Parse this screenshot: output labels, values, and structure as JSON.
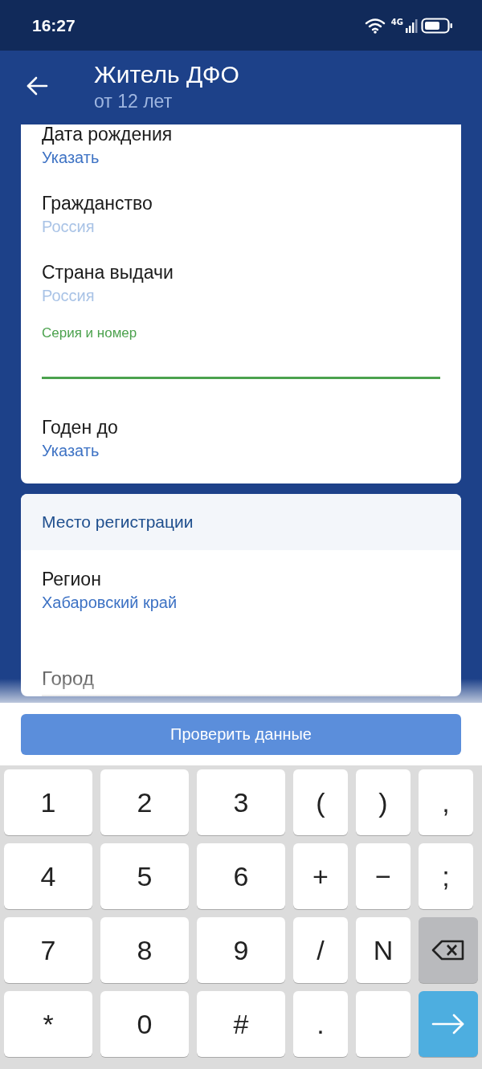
{
  "status_bar": {
    "time": "16:27",
    "network": "4G"
  },
  "header": {
    "title": "Житель ДФО",
    "subtitle": "от 12 лет"
  },
  "document_card": {
    "fields": [
      {
        "kind": "select",
        "label": "Дата рождения",
        "value": "Указать",
        "disabled": false
      },
      {
        "kind": "select",
        "label": "Гражданство",
        "value": "Россия",
        "disabled": true
      },
      {
        "kind": "select",
        "label": "Страна выдачи",
        "value": "Россия",
        "disabled": true
      },
      {
        "kind": "input",
        "label": "Серия и номер",
        "focused": true
      },
      {
        "kind": "select",
        "label": "Годен до",
        "value": "Указать",
        "disabled": false
      }
    ]
  },
  "registration_card": {
    "title": "Место регистрации",
    "fields": [
      {
        "kind": "select",
        "label": "Регион",
        "value": "Хабаровский край",
        "disabled": false
      },
      {
        "kind": "input",
        "placeholder": "Город",
        "focused": false
      }
    ]
  },
  "submit_button": "Проверить данные",
  "keyboard": {
    "rows": [
      [
        {
          "kind": "char",
          "label": "1"
        },
        {
          "kind": "char",
          "label": "2"
        },
        {
          "kind": "char",
          "label": "3"
        },
        {
          "kind": "char",
          "label": "("
        },
        {
          "kind": "char",
          "label": ")"
        },
        {
          "kind": "char",
          "label": ","
        }
      ],
      [
        {
          "kind": "char",
          "label": "4"
        },
        {
          "kind": "char",
          "label": "5"
        },
        {
          "kind": "char",
          "label": "6"
        },
        {
          "kind": "char",
          "label": "+"
        },
        {
          "kind": "char",
          "label": "−"
        },
        {
          "kind": "char",
          "label": ";"
        }
      ],
      [
        {
          "kind": "char",
          "label": "7"
        },
        {
          "kind": "char",
          "label": "8"
        },
        {
          "kind": "char",
          "label": "9"
        },
        {
          "kind": "char",
          "label": "/"
        },
        {
          "kind": "char",
          "label": "N"
        },
        {
          "kind": "backspace"
        }
      ],
      [
        {
          "kind": "char",
          "label": "*"
        },
        {
          "kind": "char",
          "label": "0"
        },
        {
          "kind": "char",
          "label": "#"
        },
        {
          "kind": "char",
          "label": "."
        },
        {
          "kind": "empty"
        },
        {
          "kind": "enter"
        }
      ]
    ]
  }
}
